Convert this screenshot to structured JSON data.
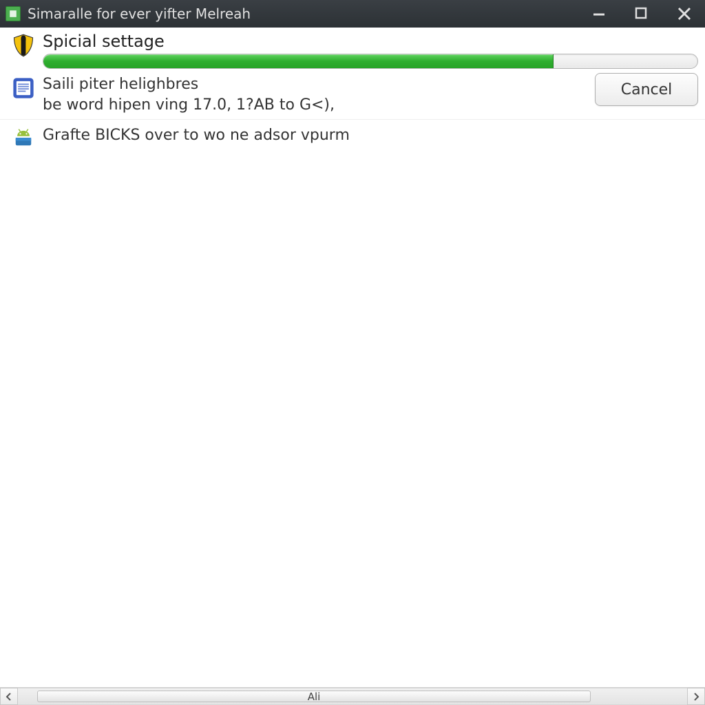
{
  "window": {
    "title": "Simaralle for ever yifter Melreah"
  },
  "section1": {
    "heading": "Spicial settage",
    "progress_percent": 78
  },
  "section2": {
    "line1": "Saili piter helighbres",
    "line2": "be word hipen ving 17.0, 1?AB to G<),"
  },
  "section3": {
    "text": "Grafte BICKS over to wo ne adsor vpurm"
  },
  "buttons": {
    "cancel": "Cancel"
  },
  "scrollbar": {
    "thumb_label": "Ali"
  },
  "icons": {
    "app": "app-icon",
    "shield": "shield-icon",
    "document": "document-icon",
    "android": "android-icon",
    "minimize": "minimize-icon",
    "maximize": "maximize-icon",
    "close": "close-icon",
    "chevron_left": "chevron-left-icon",
    "chevron_right": "chevron-right-icon"
  },
  "colors": {
    "titlebar_bg": "#2f3438",
    "progress_fill": "#2fae2f",
    "button_border": "#adadad"
  }
}
